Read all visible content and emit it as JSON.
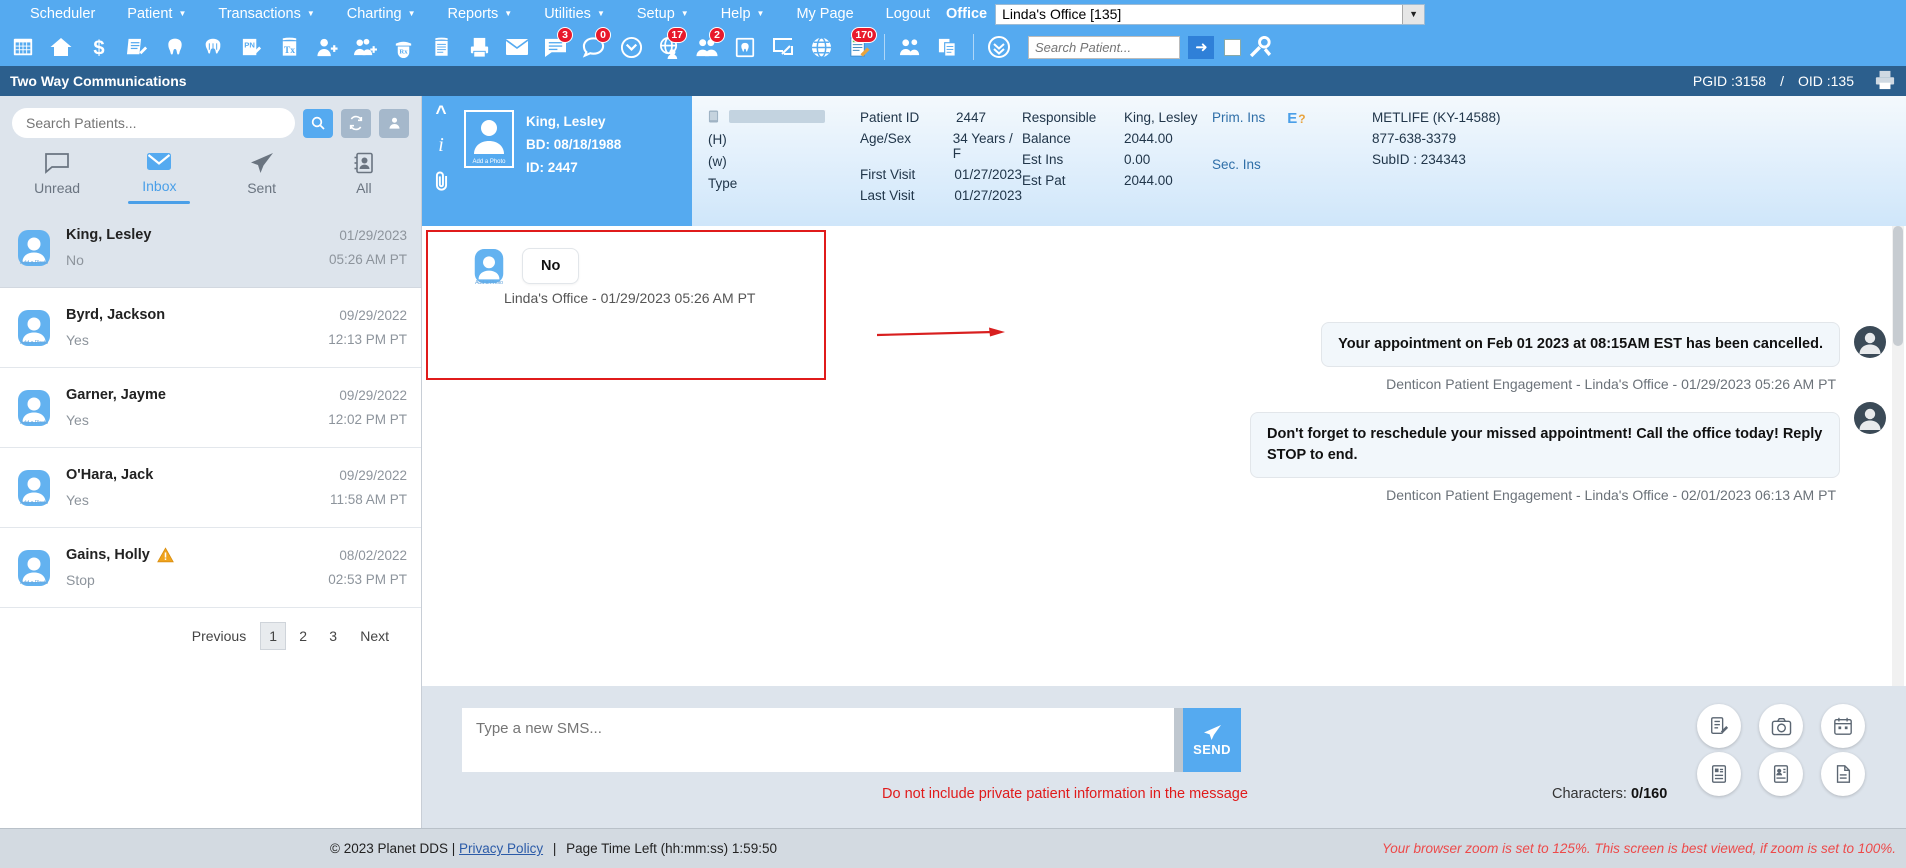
{
  "menu": {
    "items": [
      {
        "label": "Scheduler",
        "caret": false
      },
      {
        "label": "Patient",
        "caret": true
      },
      {
        "label": "Transactions",
        "caret": true
      },
      {
        "label": "Charting",
        "caret": true
      },
      {
        "label": "Reports",
        "caret": true
      },
      {
        "label": "Utilities",
        "caret": true
      },
      {
        "label": "Setup",
        "caret": true
      },
      {
        "label": "Help",
        "caret": true
      },
      {
        "label": "My Page",
        "caret": false
      },
      {
        "label": "Logout",
        "caret": false
      }
    ],
    "office_label": "Office",
    "office_value": "Linda's Office [135]"
  },
  "toolbar": {
    "icons": [
      {
        "name": "calendar-grid-icon",
        "badge": null
      },
      {
        "name": "home-icon",
        "badge": null
      },
      {
        "name": "dollar-icon",
        "badge": null
      },
      {
        "name": "notes-edit-icon",
        "badge": null
      },
      {
        "name": "tooth-icon",
        "badge": null
      },
      {
        "name": "perio-chart-icon",
        "badge": null
      },
      {
        "name": "progress-note-icon",
        "badge": null
      },
      {
        "name": "treatment-plan-icon",
        "badge": null
      },
      {
        "name": "add-patient-icon",
        "badge": null
      },
      {
        "name": "add-group-icon",
        "badge": null
      },
      {
        "name": "prescription-icon",
        "badge": null
      },
      {
        "name": "ledger-icon",
        "badge": null
      },
      {
        "name": "printer-icon",
        "badge": null
      },
      {
        "name": "envelope-icon",
        "badge": null
      },
      {
        "name": "message-icon",
        "badge": "3"
      },
      {
        "name": "chat-bubble-icon",
        "badge": "0"
      },
      {
        "name": "clock-icon",
        "badge": null
      },
      {
        "name": "globe-person-icon",
        "badge": "17"
      },
      {
        "name": "people-icon",
        "badge": "2"
      },
      {
        "name": "tooth-box-icon",
        "badge": null
      },
      {
        "name": "screen-export-icon",
        "badge": null
      },
      {
        "name": "globe-icon",
        "badge": null
      },
      {
        "name": "form-edit-icon",
        "badge": "170"
      },
      {
        "name": "group-users-icon",
        "badge": null
      },
      {
        "name": "multi-doc-icon",
        "badge": null
      },
      {
        "name": "chevrons-down-icon",
        "badge": null
      }
    ],
    "search_placeholder": "Search Patient...",
    "go_label": "➜"
  },
  "titlebar": {
    "title": "Two Way Communications",
    "pgid": "PGID :3158",
    "separator": "/",
    "oid": "OID :135"
  },
  "sidebar": {
    "search_placeholder": "Search Patients...",
    "buttons": [
      {
        "name": "search-button",
        "icon": "search-icon"
      },
      {
        "name": "refresh-button",
        "icon": "refresh-icon"
      },
      {
        "name": "person-button",
        "icon": "person-icon"
      }
    ],
    "tabs": [
      {
        "label": "Unread",
        "icon": "unread-message-icon",
        "active": false
      },
      {
        "label": "Inbox",
        "icon": "inbox-envelope-icon",
        "active": true
      },
      {
        "label": "Sent",
        "icon": "sent-paper-plane-icon",
        "active": false
      },
      {
        "label": "All",
        "icon": "all-contacts-icon",
        "active": false
      }
    ],
    "avatar_caption": "Add a Photo",
    "conversations": [
      {
        "name": "King, Lesley",
        "preview": "No",
        "date": "01/29/2023",
        "time": "05:26 AM PT",
        "selected": true,
        "warning": false
      },
      {
        "name": "Byrd, Jackson",
        "preview": "Yes",
        "date": "09/29/2022",
        "time": "12:13 PM PT",
        "selected": false,
        "warning": false
      },
      {
        "name": "Garner, Jayme",
        "preview": "Yes",
        "date": "09/29/2022",
        "time": "12:02 PM PT",
        "selected": false,
        "warning": false
      },
      {
        "name": "O'Hara, Jack",
        "preview": "Yes",
        "date": "09/29/2022",
        "time": "11:58 AM PT",
        "selected": false,
        "warning": false
      },
      {
        "name": "Gains, Holly",
        "preview": "Stop",
        "date": "08/02/2022",
        "time": "02:53 PM PT",
        "selected": false,
        "warning": true
      }
    ],
    "pagination": {
      "previous": "Previous",
      "pages": [
        "1",
        "2",
        "3"
      ],
      "current": "1",
      "next": "Next"
    }
  },
  "patient": {
    "name": "King, Lesley",
    "birthdate": "BD: 08/18/1988",
    "id_line": "ID: 2447",
    "photo_caption": "Add a Photo",
    "contact": {
      "home_label": "(H)",
      "work_label": "(w)",
      "type_label": "Type",
      "home_value": "",
      "work_value": "",
      "type_value": ""
    },
    "col1": [
      {
        "k": "Patient ID",
        "v": "2447"
      },
      {
        "k": "Age/Sex",
        "v": "34 Years / F"
      },
      {
        "k": "First Visit",
        "v": "01/27/2023"
      },
      {
        "k": "Last Visit",
        "v": "01/27/2023"
      }
    ],
    "col2": [
      {
        "k": "Responsible",
        "v": "King, Lesley"
      },
      {
        "k": "Balance",
        "v": "2044.00"
      },
      {
        "k": "Est Ins",
        "v": "0.00"
      },
      {
        "k": "Est Pat",
        "v": "2044.00"
      }
    ],
    "prim_ins_label": "Prim. Ins",
    "prim_ins_badge": "E",
    "prim_ins_badge_q": "?",
    "sec_ins_label": "Sec. Ins",
    "insurance": {
      "carrier": "METLIFE (KY-14588)",
      "phone": "877-638-3379",
      "subid": "SubID : 234343"
    }
  },
  "conversation": {
    "incoming": {
      "text": "No",
      "meta": "Linda's Office - 01/29/2023 05:26 AM PT"
    },
    "outgoing": [
      {
        "text": "Your appointment on Feb 01 2023 at 08:15AM EST has been cancelled.",
        "meta": "Denticon Patient Engagement - Linda's Office - 01/29/2023 05:26 AM PT"
      },
      {
        "text": "Don't forget to reschedule your missed appointment! Call the office today! Reply STOP to end.",
        "meta": "Denticon Patient Engagement - Linda's Office - 02/01/2023 06:13 AM PT"
      }
    ]
  },
  "composer": {
    "placeholder": "Type a new SMS...",
    "send_label": "SEND",
    "warning": "Do not include private patient information in the message",
    "characters_label": "Characters:",
    "characters_value": "0/160",
    "actions": [
      {
        "name": "note-template-icon"
      },
      {
        "name": "camera-icon"
      },
      {
        "name": "calendar-icon"
      },
      {
        "name": "document-list-icon"
      },
      {
        "name": "form-person-icon"
      },
      {
        "name": "file-icon"
      }
    ]
  },
  "footer": {
    "copyright": "© 2023 Planet DDS |",
    "privacy": "Privacy Policy",
    "sep": "|",
    "timer": "Page Time Left (hh:mm:ss) 1:59:50",
    "zoom_warning": "Your browser zoom is set to 125%. This screen is best viewed, if zoom is set to 100%."
  },
  "colors": {
    "brand_blue": "#55aaf0",
    "title_blue": "#2c5f8d",
    "accent_red": "#e01b1b",
    "panel_grey": "#dde4ec"
  }
}
